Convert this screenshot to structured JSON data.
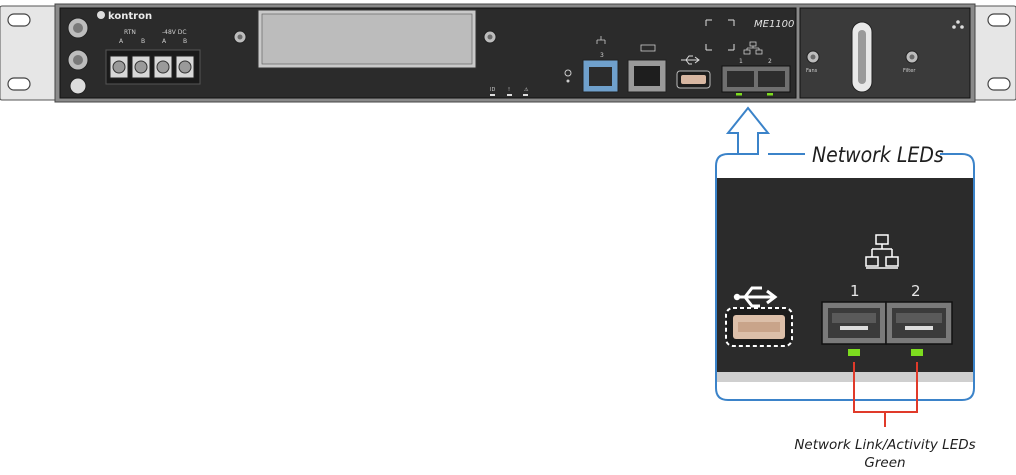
{
  "device": {
    "brand": "kontron",
    "model": "ME1100",
    "power_labels": {
      "rtn": "RTN",
      "dc": "-48V DC",
      "a1": "A",
      "b1": "B",
      "a2": "A",
      "b2": "B"
    },
    "fan_labels": {
      "fans": "Fans",
      "filter": "Filter"
    },
    "port3_label": "3",
    "sfp_labels": [
      "1",
      "2"
    ],
    "led_labels": [
      "ID",
      "!",
      "⚠"
    ]
  },
  "callout": {
    "title": "Network LEDs",
    "port_labels": [
      "1",
      "2"
    ],
    "caption_line1": "Network Link/Activity LEDs",
    "caption_line2": "Green"
  },
  "colors": {
    "panel": "#2b2b2b",
    "callout_border": "#3b83c9",
    "led_green": "#7ddc1f",
    "led_connector": "#e03a2a",
    "arrow": "#3b83c9"
  }
}
